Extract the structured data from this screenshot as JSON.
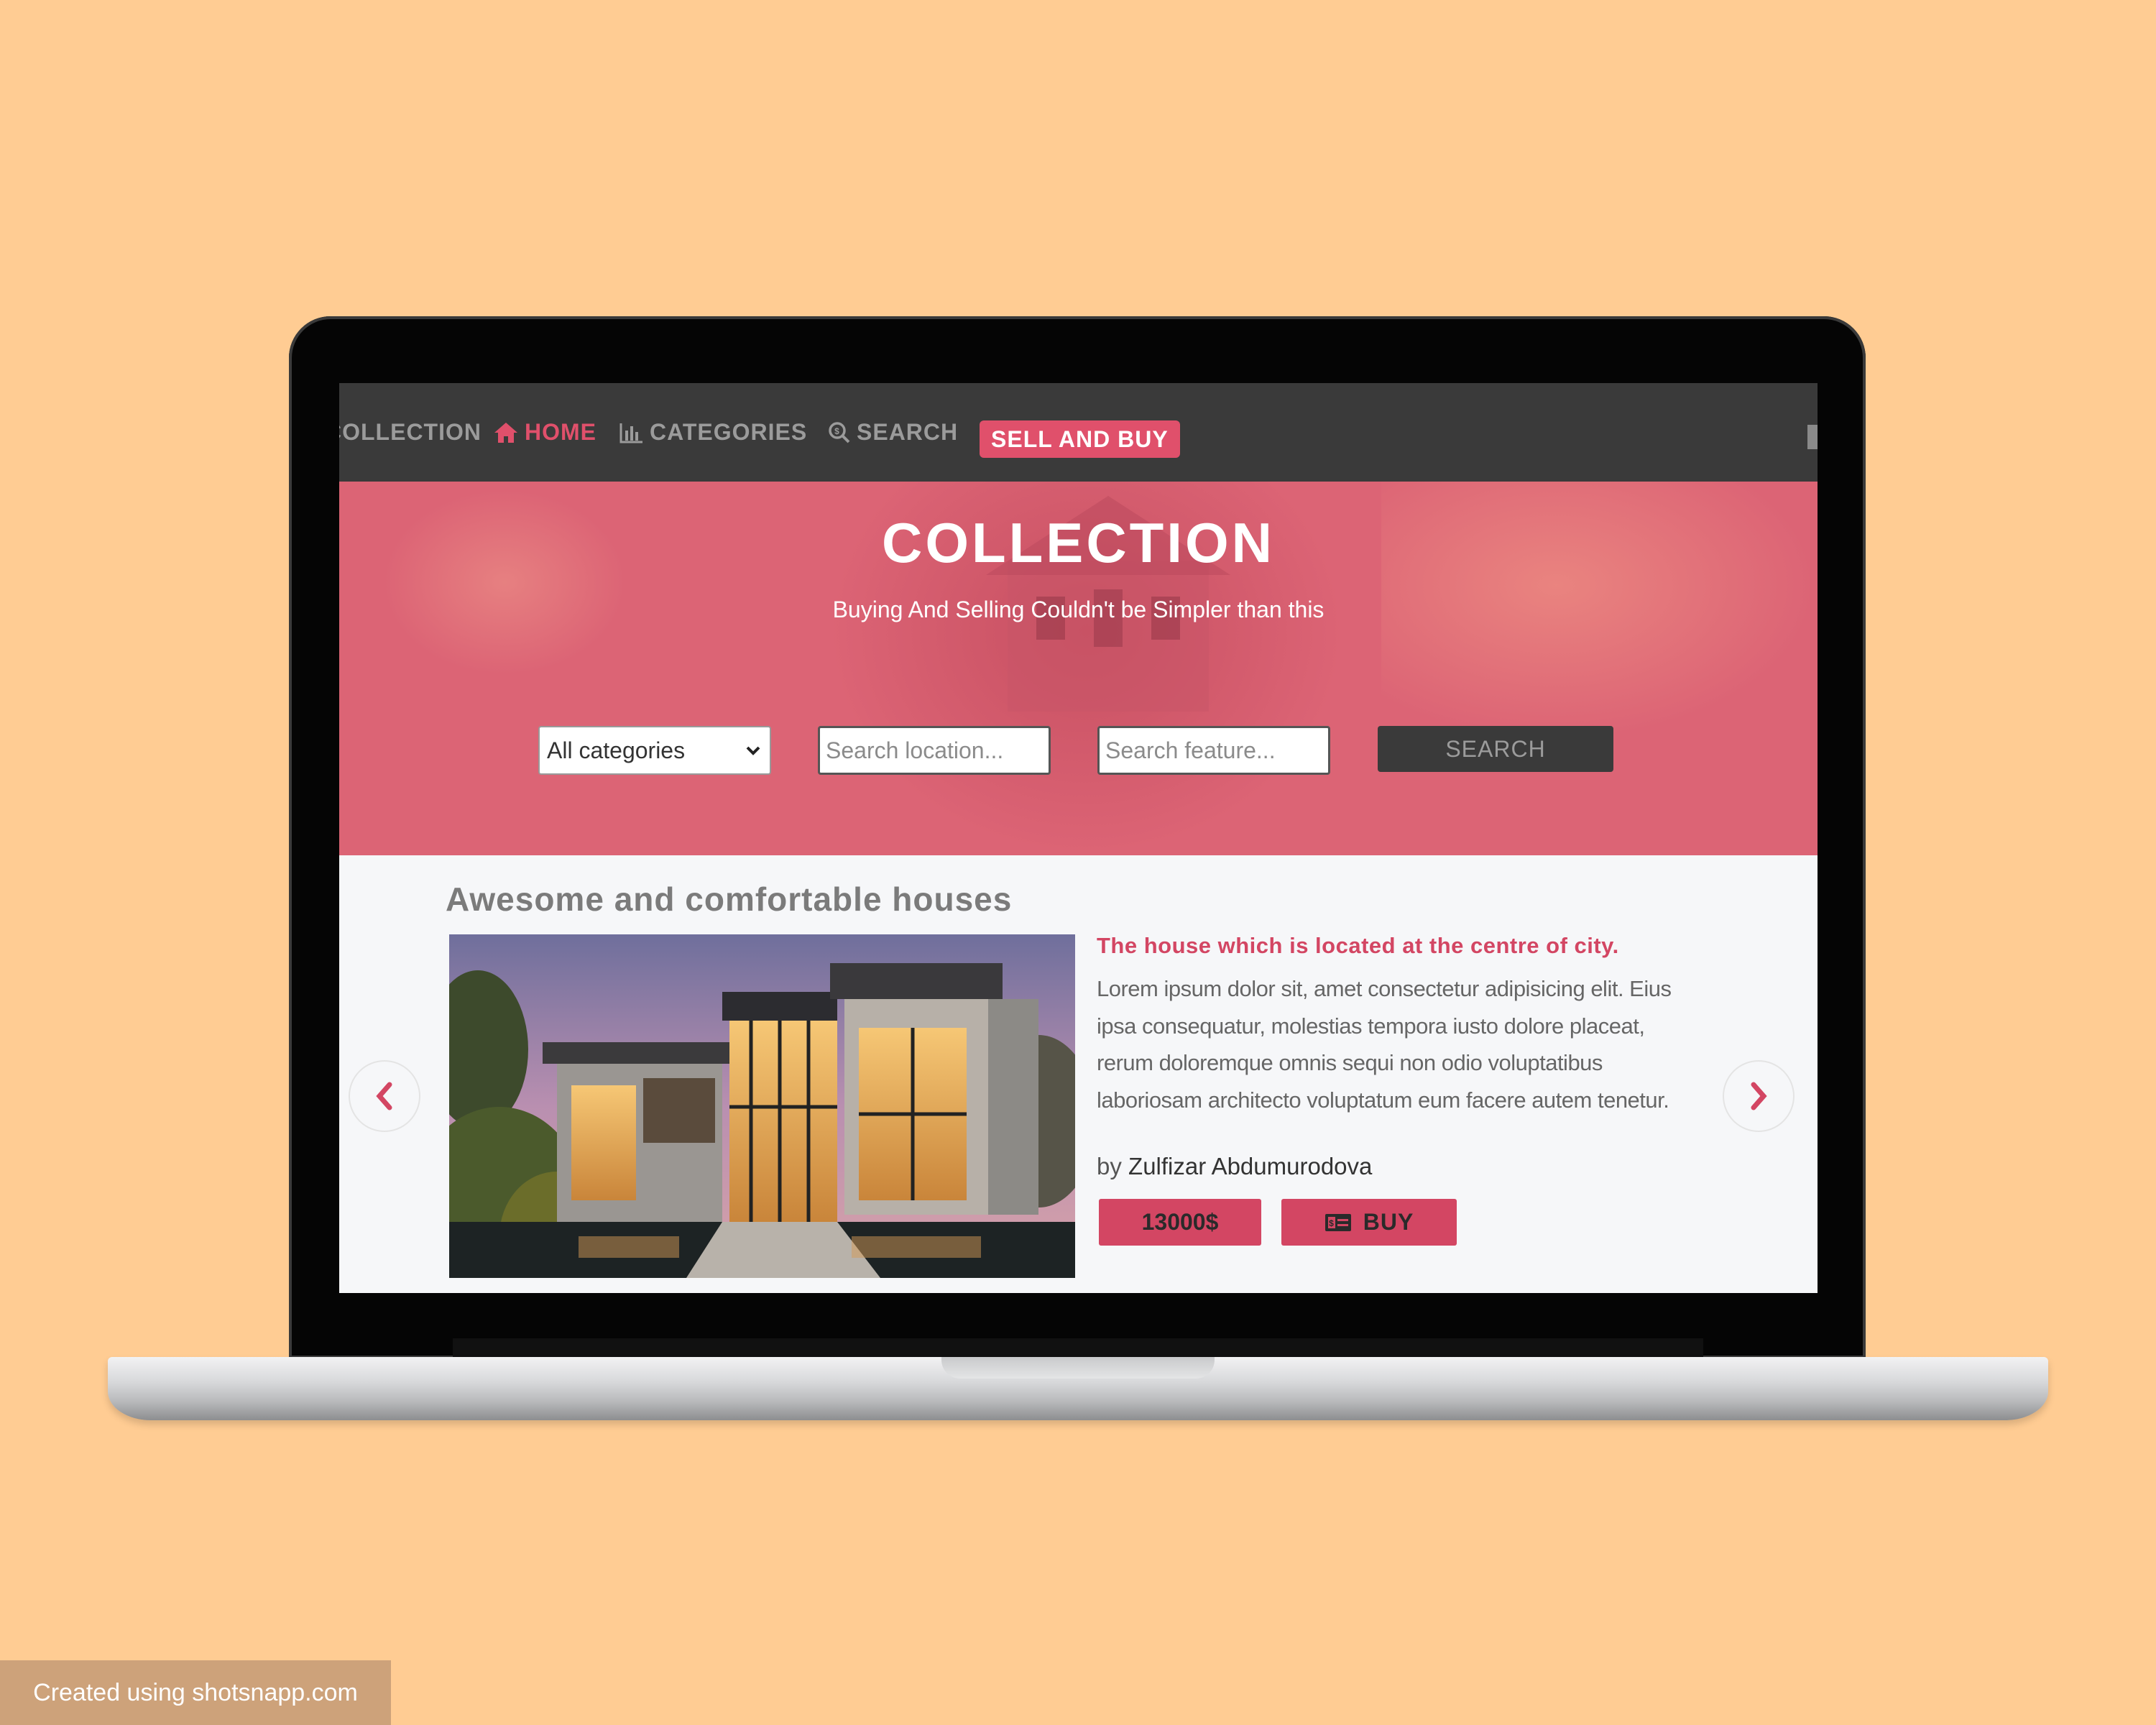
{
  "nav": {
    "brand": "COLLECTION",
    "home": "HOME",
    "categories": "CATEGORIES",
    "search": "SEARCH",
    "sell_and_buy": "SELL AND BUY"
  },
  "hero": {
    "title": "COLLECTION",
    "subtitle": "Buying And Selling Couldn't be Simpler than this",
    "category_selected": "All categories",
    "location_placeholder": "Search location...",
    "feature_placeholder": "Search feature...",
    "search_button": "SEARCH"
  },
  "listing": {
    "section_title": "Awesome and comfortable houses",
    "heading": "The house which is located at the centre of city.",
    "description": "Lorem ipsum dolor sit, amet consectetur adipisicing elit. Eius ipsa consequatur, molestias tempora iusto dolore placeat, rerum doloremque omnis sequi non odio voluptatibus laboriosam architecto voluptatum eum facere autem tenetur.",
    "by_label": "by",
    "author": "Zulfizar Abdumurodova",
    "price": "13000$",
    "buy_label": "BUY"
  },
  "watermark": "Created using shotsnapp.com",
  "colors": {
    "accent": "#e0506b",
    "navbar": "#3a3a3a",
    "hero_overlay": "#dc6475",
    "background": "#ffcc93"
  },
  "icons": [
    "home-icon",
    "chart-icon",
    "search-icon",
    "chevron-down-icon",
    "money-bill-icon",
    "chevron-left-icon",
    "chevron-right-icon"
  ]
}
